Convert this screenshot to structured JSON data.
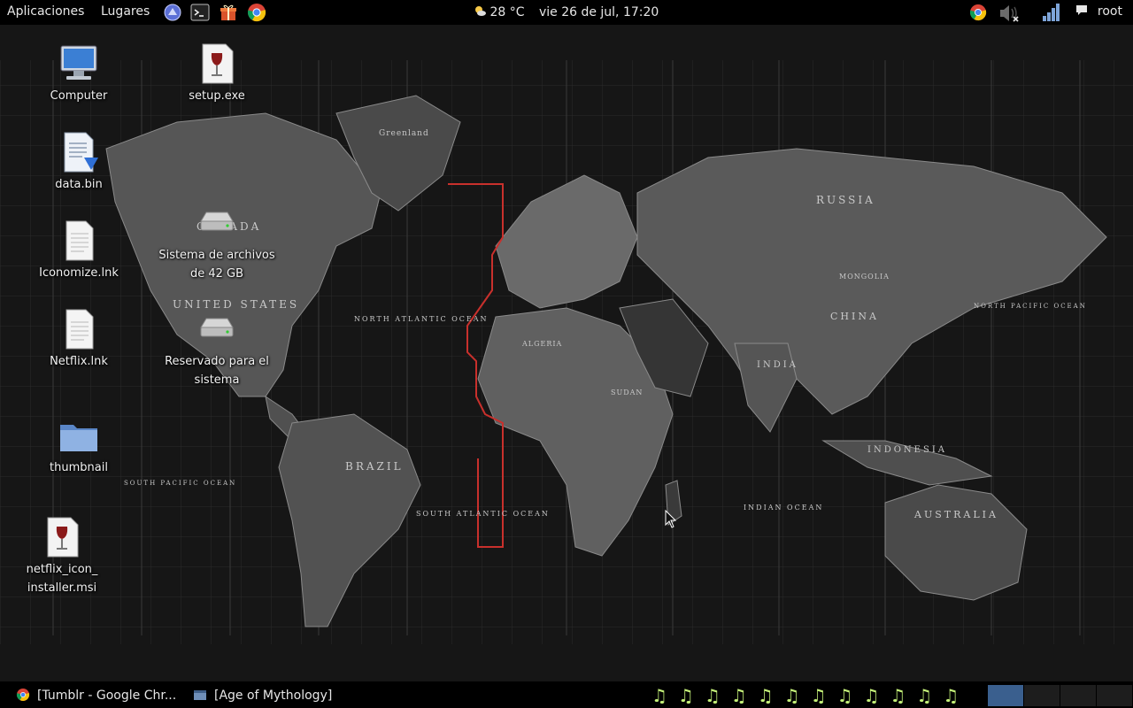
{
  "top_panel": {
    "applications": "Aplicaciones",
    "places": "Lugares",
    "launchers": [
      "settings-icon",
      "terminal-icon",
      "gift-icon",
      "chrome-icon"
    ],
    "weather": "28 °C",
    "datetime": "vie 26 de jul, 17:20",
    "tray": [
      "chrome-icon",
      "speaker-muted-icon",
      "network-signal-icon"
    ],
    "user": "root"
  },
  "desktop": {
    "icons": [
      {
        "label": "Computer",
        "icon": "computer-icon"
      },
      {
        "label": "setup.exe",
        "icon": "wine-icon"
      },
      {
        "label": "data.bin",
        "icon": "file-download-icon"
      },
      {
        "label": "Sistema de archivos de 42 GB",
        "icon": "drive-icon"
      },
      {
        "label": "Iconomize.lnk",
        "icon": "document-icon"
      },
      {
        "label": "Reservado para el sistema",
        "icon": "drive-icon"
      },
      {
        "label": "Netflix.lnk",
        "icon": "document-icon"
      },
      {
        "label": "thumbnail",
        "icon": "folder-icon"
      },
      {
        "label": "netflix_icon_ installer.msi",
        "icon": "wine-icon"
      }
    ],
    "wallpaper_labels": {
      "canada": "CANADA",
      "usa": "UNITED STATES",
      "brazil": "BRAZIL",
      "russia": "RUSSIA",
      "china": "CHINA",
      "india": "INDIA",
      "australia": "AUSTRALIA",
      "indonesia": "INDONESIA",
      "mongolia": "MONGOLIA",
      "greenland": "Greenland",
      "algeria": "ALGERIA",
      "sudan": "SUDAN",
      "north_atlantic": "NORTH ATLANTIC OCEAN",
      "south_atlantic": "SOUTH ATLANTIC OCEAN",
      "indian_ocean": "INDIAN OCEAN",
      "north_pacific": "NORTH PACIFIC OCEAN",
      "south_pacific": "SOUTH PACIFIC OCEAN"
    }
  },
  "bottom_panel": {
    "tasks": [
      {
        "label": "[Tumblr - Google Chr...",
        "icon": "chrome-icon"
      },
      {
        "label": "[Age of Mythology]",
        "icon": "window-icon"
      }
    ],
    "notes": "♫♫♫♫♫♫♫♫♫♫♫♫",
    "workspaces": 4,
    "active_workspace": 1
  },
  "colors": {
    "panel_bg": "#000000",
    "active_workspace": "#3a5f8e",
    "music_note": "#c6f37a",
    "timezone_line": "#c8302c"
  }
}
